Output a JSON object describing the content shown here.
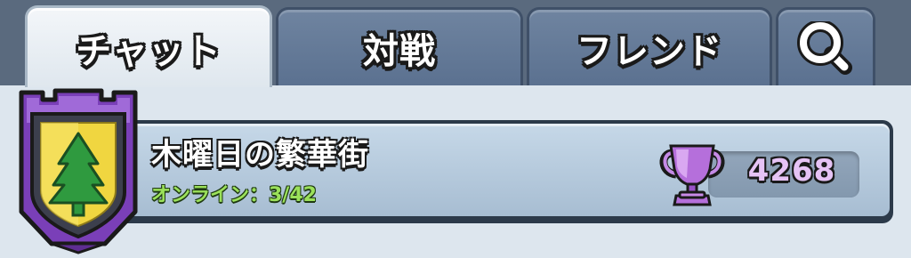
{
  "tabs": {
    "chat": "チャット",
    "battle": "対戦",
    "friends": "フレンド",
    "search_icon": "search-icon"
  },
  "clan": {
    "name": "木曜日の繁華街",
    "online_label": "オンライン：3/42",
    "trophies": "4268",
    "badge_icon": "tree-icon",
    "trophy_icon": "trophy-icon"
  },
  "colors": {
    "online_text": "#9be15a",
    "trophy_text": "#e6c3f5",
    "badge_purple": "#8a4fc9",
    "badge_yellow": "#f0d640",
    "tree_green": "#2f9a3f"
  }
}
